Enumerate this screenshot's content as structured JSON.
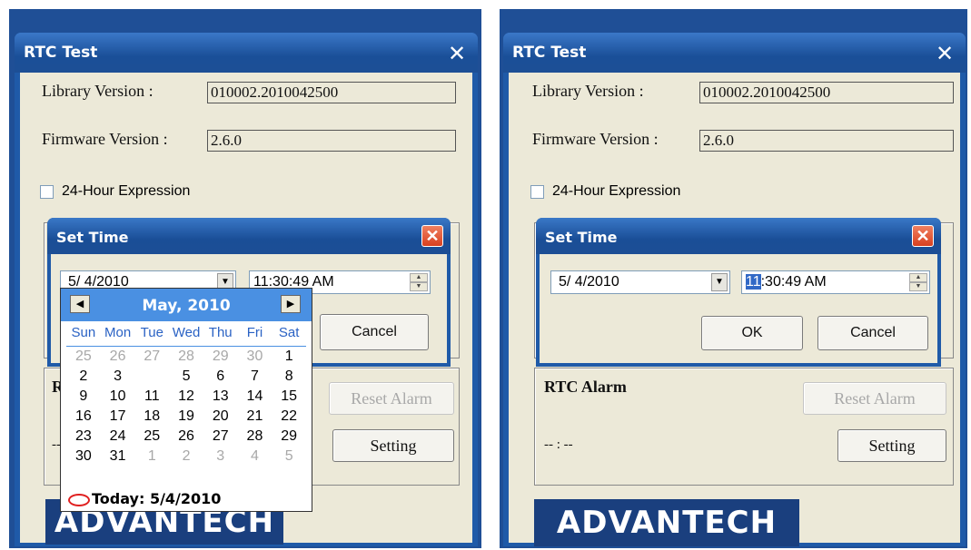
{
  "left": {
    "window_title": "RTC Test",
    "library_label": "Library Version :",
    "library_value": "010002.2010042500",
    "firmware_label": "Firmware Version :",
    "firmware_value": "2.6.0",
    "hour24_label": "24-Hour Expression",
    "rtc_alarm_label": "RT",
    "alarm_time": "--",
    "reset_alarm": "Reset Alarm",
    "setting": "Setting",
    "logo": "ADVANTECH",
    "dialog": {
      "title": "Set Time",
      "date_value": "5/ 4/2010",
      "time_value": "11:30:49 AM",
      "cancel": "Cancel"
    },
    "calendar": {
      "month": "May, 2010",
      "weekdays": [
        "Sun",
        "Mon",
        "Tue",
        "Wed",
        "Thu",
        "Fri",
        "Sat"
      ],
      "weeks": [
        [
          "25",
          "26",
          "27",
          "28",
          "29",
          "30",
          "1"
        ],
        [
          "2",
          "3",
          "4",
          "5",
          "6",
          "7",
          "8"
        ],
        [
          "9",
          "10",
          "11",
          "12",
          "13",
          "14",
          "15"
        ],
        [
          "16",
          "17",
          "18",
          "19",
          "20",
          "21",
          "22"
        ],
        [
          "23",
          "24",
          "25",
          "26",
          "27",
          "28",
          "29"
        ],
        [
          "30",
          "31",
          "1",
          "2",
          "3",
          "4",
          "5"
        ]
      ],
      "selected_day": "4",
      "today_label": "Today: 5/4/2010"
    }
  },
  "right": {
    "window_title": "RTC Test",
    "library_label": "Library Version :",
    "library_value": "010002.2010042500",
    "firmware_label": "Firmware Version :",
    "firmware_value": "2.6.0",
    "hour24_label": "24-Hour Expression",
    "rtc_alarm_label": "RTC Alarm",
    "alarm_time": "-- : --",
    "reset_alarm": "Reset Alarm",
    "setting": "Setting",
    "logo": "ADVANTECH",
    "dialog": {
      "title": "Set Time",
      "date_value": "5/ 4/2010",
      "time_hour": "11",
      "time_rest": ":30:49 AM",
      "ok": "OK",
      "cancel": "Cancel"
    }
  },
  "colors": {
    "title_bar": "#1f5aa8",
    "client_bg": "#ece9d8",
    "calendar_header": "#4a90e2",
    "logo_bg": "#1a3f7e",
    "highlight": "#e02020"
  }
}
